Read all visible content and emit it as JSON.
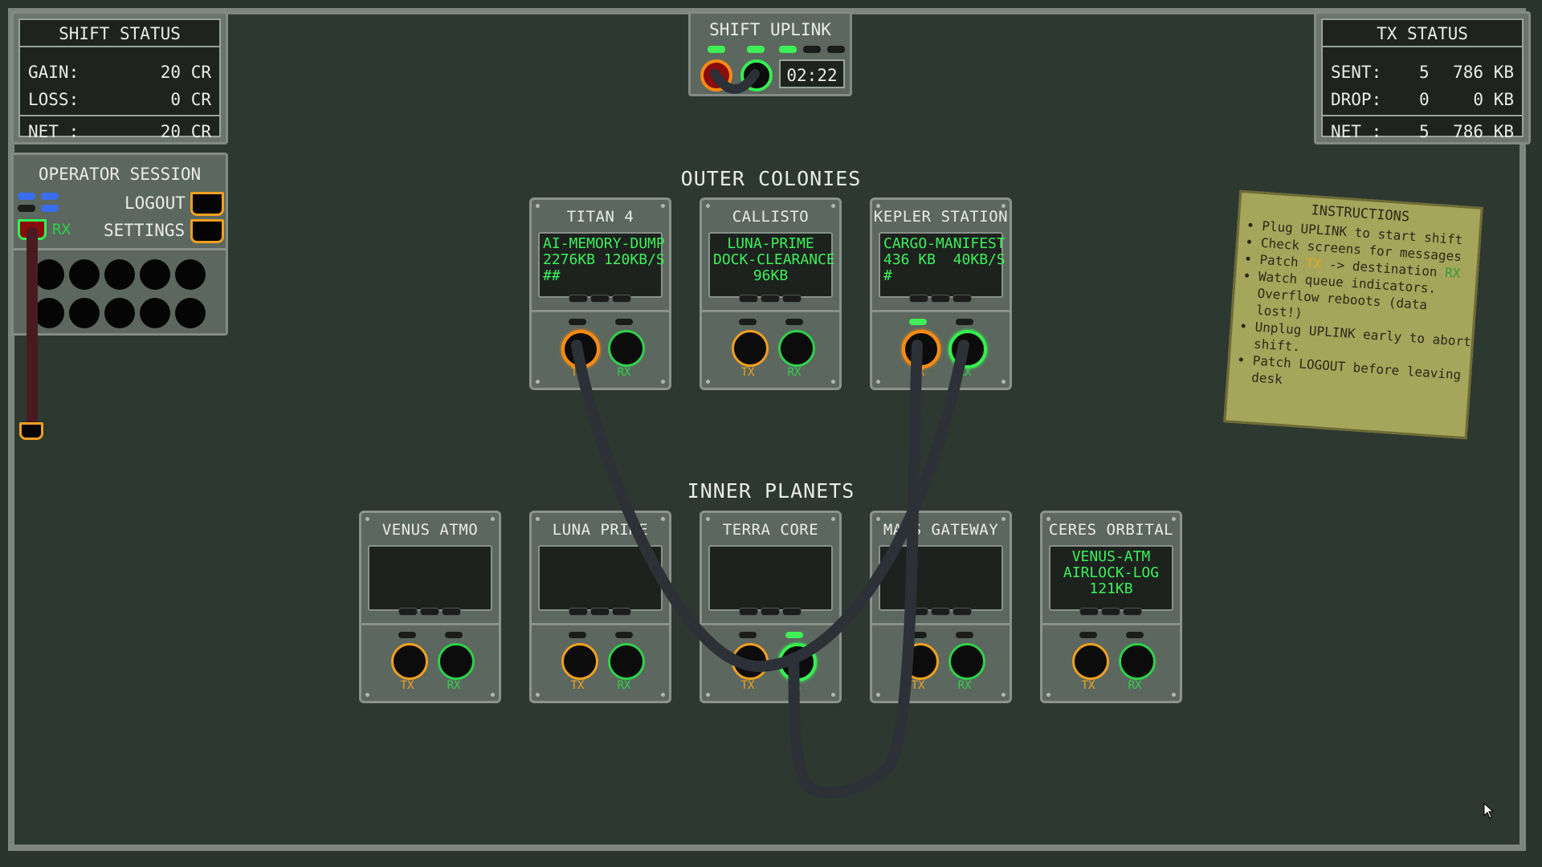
{
  "shift_status": {
    "title": "SHIFT STATUS",
    "rows": [
      {
        "key": "GAIN:",
        "value": "20 CR"
      },
      {
        "key": "LOSS:",
        "value": "0 CR"
      }
    ],
    "net": {
      "key": "NET :",
      "value": "20 CR"
    }
  },
  "uplink": {
    "title": "SHIFT UPLINK",
    "timer": "02:22"
  },
  "tx_status": {
    "title": "TX STATUS",
    "rows": [
      {
        "key": "SENT:",
        "count": "5",
        "value": "786 KB"
      },
      {
        "key": "DROP:",
        "count": "0",
        "value": "0 KB"
      }
    ],
    "net": {
      "key": "NET :",
      "count": "5",
      "value": "786 KB"
    }
  },
  "operator": {
    "title": "OPERATOR SESSION",
    "logout_label": "LOGOUT",
    "settings_label": "SETTINGS",
    "rx_label": "RX"
  },
  "sections": {
    "outer": "OUTER COLONIES",
    "inner": "INNER PLANETS"
  },
  "jack_labels": {
    "tx": "TX",
    "rx": "RX"
  },
  "outer_panels": [
    {
      "name": "TITAN 4",
      "screen": "AI-MEMORY-DUMP\n2276KB 120KB/S\n##"
    },
    {
      "name": "CALLISTO",
      "screen": "LUNA-PRIME\nDOCK-CLEARANCE\n96KB"
    },
    {
      "name": "KEPLER STATION",
      "screen": "CARGO-MANIFEST\n436 KB  40KB/S\n#"
    }
  ],
  "inner_panels": [
    {
      "name": "VENUS ATMO",
      "screen": ""
    },
    {
      "name": "LUNA PRIME",
      "screen": ""
    },
    {
      "name": "TERRA CORE",
      "screen": ""
    },
    {
      "name": "MARS GATEWAY",
      "screen": ""
    },
    {
      "name": "CERES ORBITAL",
      "screen": "VENUS-ATM\nAIRLOCK-LOG\n121KB"
    }
  ],
  "instructions": {
    "title": "INSTRUCTIONS",
    "items": [
      "Plug UPLINK to start shift",
      "Check screens for messages",
      "Watch queue indicators. Overflow reboots (data lost!)",
      "Unplug UPLINK early to abort shift.",
      "Patch LOGOUT before leaving desk"
    ],
    "patch_prefix": "Patch",
    "patch_tx": "TX",
    "patch_mid": "-> destination",
    "patch_rx": "RX"
  },
  "colors": {
    "screen_text": "#3cf05a",
    "tx": "#f0a020",
    "rx": "#2fd04a",
    "cable": "#2c3138"
  }
}
